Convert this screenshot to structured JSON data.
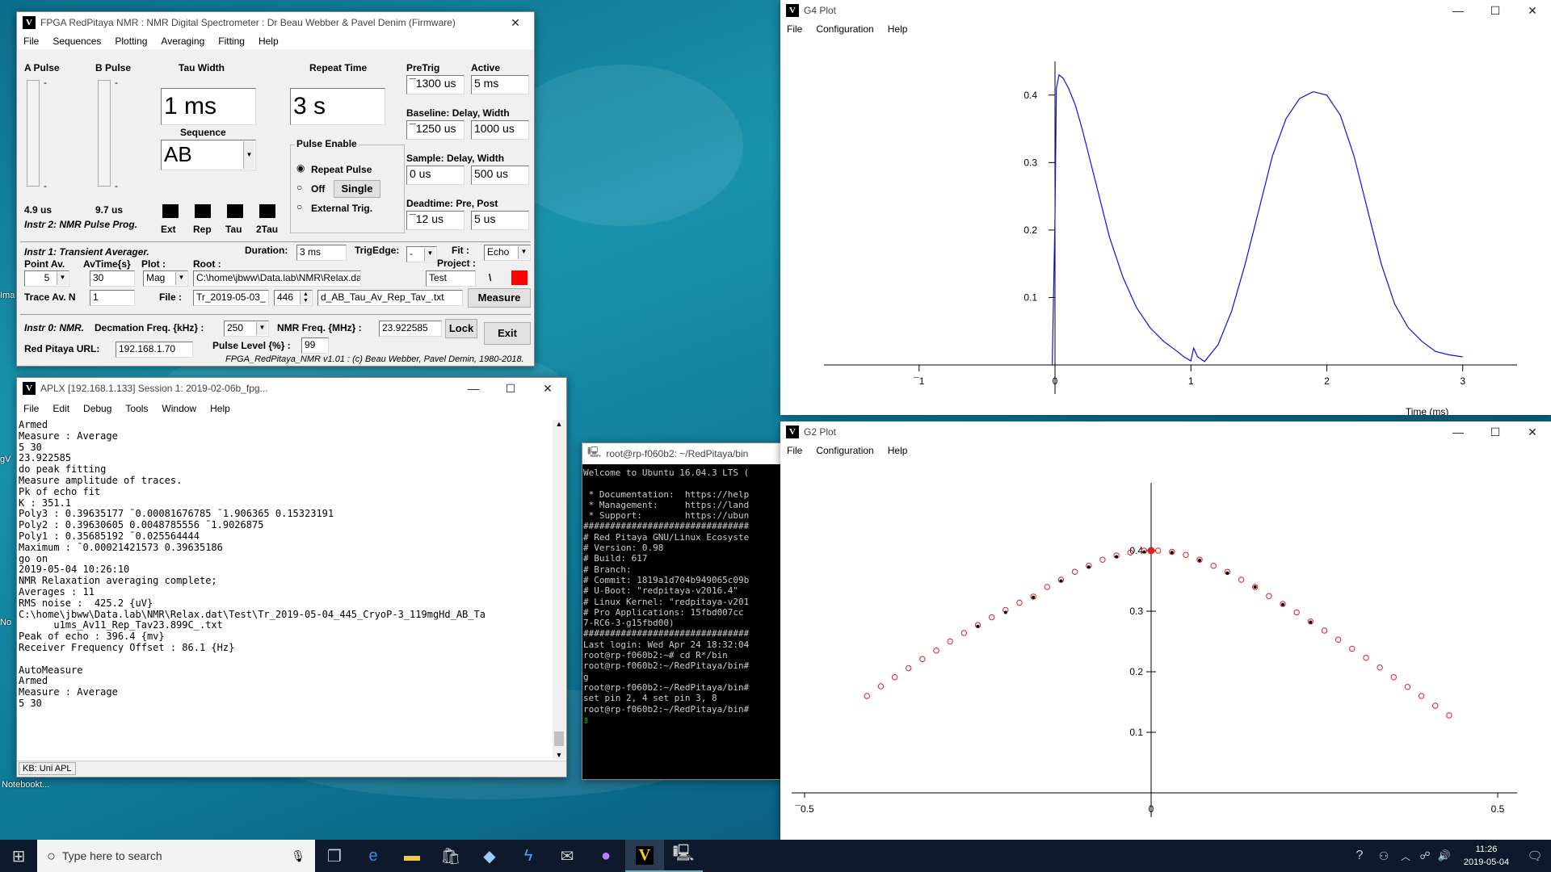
{
  "desktop": {
    "icons": [
      "Ima",
      "gV",
      "No",
      "Notebookt..."
    ]
  },
  "nmr": {
    "title": "FPGA RedPitaya NMR : NMR Digital Spectrometer : Dr Beau Webber & Pavel Denim (Firmware)",
    "menu": [
      "File",
      "Sequences",
      "Plotting",
      "Averaging",
      "Fitting",
      "Help"
    ],
    "a_pulse_label": "A Pulse",
    "b_pulse_label": "B Pulse",
    "tau_label": "Tau Width",
    "repeat_label": "Repeat Time",
    "tau_value": "1 ms",
    "repeat_value": "3 s",
    "sequence_label": "Sequence",
    "sequence_value": "AB",
    "a_value": "4.9 us",
    "b_value": "9.7 us",
    "instr2": "Instr 2: NMR Pulse Prog.",
    "led_labels": [
      "Ext",
      "Rep",
      "Tau",
      "2Tau"
    ],
    "pulse_enable": "Pulse Enable",
    "repeat_pulse": "Repeat Pulse",
    "off": "Off",
    "single": "Single",
    "external": "External Trig.",
    "pretrig_label": "PreTrig",
    "active_label": "Active",
    "pretrig": "¯1300 us",
    "active": "5 ms",
    "baseline_label": "Baseline: Delay, Width",
    "baseline_delay": "¯1250 us",
    "baseline_width": "1000 us",
    "sample_label": "Sample: Delay, Width",
    "sample_delay": "0 us",
    "sample_width": "500 us",
    "dead_label": "Deadtime: Pre, Post",
    "dead_pre": "¯12 us",
    "dead_post": "5 us",
    "instr1": "Instr 1: Transient Averager.",
    "duration_label": "Duration:",
    "duration": "3 ms",
    "trigedge_label": "TrigEdge:",
    "trigedge": "-",
    "fit_label": "Fit :",
    "fit": "Echo",
    "project_label": "Project :",
    "pointav_label": "Point Av.",
    "avtime_label": "AvTime{s}",
    "plot_label": "Plot :",
    "root_label": "Root :",
    "pointav": "5",
    "avtime": "30",
    "plot": "Mag",
    "root": "C:\\home\\jbww\\Data.lab\\NMR\\Relax.dat\\",
    "project": "Test",
    "backslash": "\\",
    "traceav_label": "Trace Av. N",
    "traceav": "1",
    "file_label": "File :",
    "file1": "Tr_2019-05-03_",
    "file_num": "446",
    "file2": "d_AB_Tau_Av_Rep_Tav_.txt",
    "measure": "Measure",
    "instr0": "Instr 0: NMR.",
    "decim_label": "Decmation Freq. {kHz} :",
    "decim": "250",
    "nmrfreq_label": "NMR Freq. {MHz} :",
    "nmrfreq": "23.922585",
    "lock": "Lock",
    "exit": "Exit",
    "url_label": "Red Pitaya URL:",
    "url": "192.168.1.70",
    "level_label": "Pulse Level {%} :",
    "level": "99",
    "footer": "FPGA_RedPitaya_NMR v1.01 : (c) Beau Webber, Pavel Demin, 1980-2018."
  },
  "aplx": {
    "title": "APLX [192.168.1.133] Session 1: 2019-02-06b_fpg...",
    "menu": [
      "File",
      "Edit",
      "Debug",
      "Tools",
      "Window",
      "Help"
    ],
    "text": "Armed\nMeasure : Average\n5 30\n23.922585\ndo peak fitting\nMeasure amplitude of traces.\nPk of echo fit\nK : 351.1\nPoly3 : 0.39635177 ¯0.00081676785 ¯1.906365 0.15323191\nPoly2 : 0.39630605 0.0048785556 ¯1.9026875\nPoly1 : 0.35685192 ¯0.025564444\nMaximum : ¯0.00021421573 0.39635186\ngo on\n2019-05-04 10:26:10\nNMR Relaxation averaging complete;\nAverages : 11\nRMS noise :  425.2 {uV}\nC:\\home\\jbww\\Data.lab\\NMR\\Relax.dat\\Test\\Tr_2019-05-04_445_CryoP-3_119mgHd_AB_Ta\n      u1ms_Av11_Rep_Tav23.899C_.txt\nPeak of echo : 396.4 {mv}\nReceiver Frequency Offset : 86.1 {Hz}\n\nAutoMeasure\nArmed\nMeasure : Average\n5 30",
    "status": "KB: Uni APL"
  },
  "terminal": {
    "title": "root@rp-f060b2: ~/RedPitaya/bin",
    "text": "Welcome to Ubuntu 16.04.3 LTS (\n\n * Documentation:  https://help\n * Management:     https://land\n * Support:        https://ubun\n###############################\n# Red Pitaya GNU/Linux Ecosyste\n# Version: 0.98\n# Build: 617\n# Branch:\n# Commit: 1819a1d704b949065c09b\n# U-Boot: \"redpitaya-v2016.4\"\n# Linux Kernel: \"redpitaya-v201\n# Pro Applications: 15fbd007cc\n7-RC6-3-g15fbd00)\n###############################\nLast login: Wed Apr 24 18:32:04\nroot@rp-f060b2:~# cd R*/bin\nroot@rp-f060b2:~/RedPitaya/bin#\ng\nroot@rp-f060b2:~/RedPitaya/bin#\nset pin 2, 4 set pin 3, 8\nroot@rp-f060b2:~/RedPitaya/bin#"
  },
  "g4": {
    "title": "G4 Plot",
    "menu": [
      "File",
      "Configuration",
      "Help"
    ],
    "chart_data": {
      "type": "line",
      "xlabel": "Time (ms)",
      "ylabel": "",
      "xlim": [
        -1.7,
        3.4
      ],
      "ylim": [
        0,
        0.45
      ],
      "xticks": [
        {
          "v": -1,
          "t": "¯1"
        },
        {
          "v": 0,
          "t": "0"
        },
        {
          "v": 1,
          "t": "1"
        },
        {
          "v": 2,
          "t": "2"
        },
        {
          "v": 3,
          "t": "3"
        }
      ],
      "yticks": [
        {
          "v": 0.1,
          "t": "0.1"
        },
        {
          "v": 0.2,
          "t": "0.2"
        },
        {
          "v": 0.3,
          "t": "0.3"
        },
        {
          "v": 0.4,
          "t": "0.4"
        }
      ],
      "series": [
        {
          "color": "#1010e0",
          "x": [
            -0.02,
            0.0,
            0.01,
            0.03,
            0.06,
            0.1,
            0.15,
            0.2,
            0.3,
            0.4,
            0.5,
            0.6,
            0.7,
            0.8,
            0.9,
            0.95,
            1.0,
            1.02,
            1.05,
            1.1,
            1.2,
            1.3,
            1.4,
            1.5,
            1.6,
            1.7,
            1.8,
            1.9,
            2.0,
            2.1,
            2.2,
            2.3,
            2.4,
            2.5,
            2.6,
            2.7,
            2.8,
            2.9,
            3.0
          ],
          "y": [
            0.0,
            0.22,
            0.41,
            0.43,
            0.425,
            0.41,
            0.385,
            0.35,
            0.27,
            0.19,
            0.13,
            0.085,
            0.055,
            0.035,
            0.02,
            0.012,
            0.006,
            0.025,
            0.012,
            0.005,
            0.03,
            0.08,
            0.15,
            0.23,
            0.31,
            0.365,
            0.395,
            0.405,
            0.4,
            0.37,
            0.31,
            0.23,
            0.15,
            0.09,
            0.055,
            0.035,
            0.02,
            0.015,
            0.012
          ]
        }
      ]
    }
  },
  "g2": {
    "title": "G2 Plot",
    "menu": [
      "File",
      "Configuration",
      "Help"
    ],
    "chart_data": {
      "type": "scatter",
      "xlabel": "",
      "ylabel": "",
      "xlim": [
        -0.5,
        0.5
      ],
      "ylim": [
        0,
        0.4
      ],
      "xticks": [
        {
          "v": -0.5,
          "t": "¯0.5"
        },
        {
          "v": 0,
          "t": "0"
        },
        {
          "v": 0.5,
          "t": "0.5"
        }
      ],
      "yticks": [
        {
          "v": 0.1,
          "t": "0.1"
        },
        {
          "v": 0.2,
          "t": "0.2"
        },
        {
          "v": 0.3,
          "t": "0.3"
        },
        {
          "v": 0.4,
          "t": "0.4"
        }
      ],
      "series": [
        {
          "color": "#e02020",
          "marker": "circle",
          "x": [
            -0.41,
            -0.39,
            -0.37,
            -0.35,
            -0.33,
            -0.31,
            -0.29,
            -0.27,
            -0.25,
            -0.23,
            -0.21,
            -0.19,
            -0.17,
            -0.15,
            -0.13,
            -0.11,
            -0.09,
            -0.07,
            -0.05,
            -0.03,
            -0.01,
            0.01,
            0.03,
            0.05,
            0.07,
            0.09,
            0.11,
            0.13,
            0.15,
            0.17,
            0.19,
            0.21,
            0.23,
            0.25,
            0.27,
            0.29,
            0.31,
            0.33,
            0.35,
            0.37,
            0.39,
            0.41,
            0.43
          ],
          "y": [
            0.16,
            0.176,
            0.191,
            0.206,
            0.221,
            0.235,
            0.25,
            0.264,
            0.277,
            0.29,
            0.302,
            0.314,
            0.324,
            0.34,
            0.352,
            0.365,
            0.375,
            0.385,
            0.392,
            0.397,
            0.4,
            0.4,
            0.398,
            0.393,
            0.385,
            0.375,
            0.365,
            0.352,
            0.34,
            0.325,
            0.312,
            0.298,
            0.283,
            0.268,
            0.253,
            0.238,
            0.223,
            0.207,
            0.191,
            0.175,
            0.16,
            0.144,
            0.128
          ]
        },
        {
          "color": "#000000",
          "marker": "dot",
          "x": [
            -0.25,
            -0.21,
            -0.17,
            -0.13,
            -0.09,
            -0.05,
            -0.01,
            0.03,
            0.07,
            0.11,
            0.15,
            0.19,
            0.23
          ],
          "y": [
            0.275,
            0.298,
            0.323,
            0.35,
            0.373,
            0.39,
            0.398,
            0.397,
            0.384,
            0.363,
            0.34,
            0.311,
            0.282
          ]
        }
      ]
    }
  },
  "taskbar": {
    "search": "Type here to search",
    "time": "11:26",
    "date": "2019-05-04"
  }
}
